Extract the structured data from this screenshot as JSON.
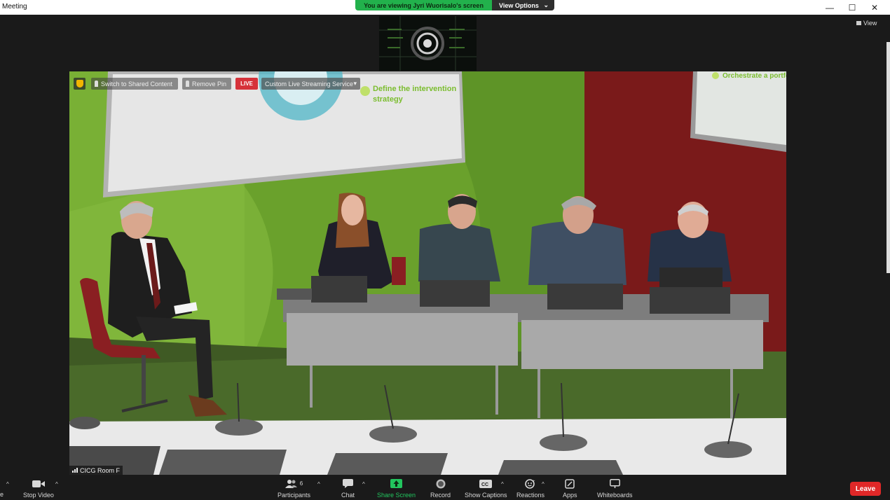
{
  "window": {
    "title": "Meeting"
  },
  "banner": {
    "viewing_text": "You are viewing Jyri Wuorisalo's screen",
    "view_options": "View Options"
  },
  "view_button": {
    "label": "View"
  },
  "video_overlay": {
    "switch_label": "Switch to Shared Content",
    "remove_pin_label": "Remove Pin",
    "live_label": "LIVE",
    "stream_label": "Custom Live Streaming Service"
  },
  "slide_text": {
    "main_slide": "Define the intervention strategy",
    "side_slide": "Orchestrate a portfolio"
  },
  "room": {
    "label": "CICG Room F"
  },
  "toolbar": {
    "stop_video": "Stop Video",
    "participants": "Participants",
    "participants_count": "6",
    "chat": "Chat",
    "share_screen": "Share Screen",
    "record": "Record",
    "show_captions": "Show Captions",
    "reactions": "Reactions",
    "apps": "Apps",
    "whiteboards": "Whiteboards",
    "leave": "Leave"
  },
  "colors": {
    "share_green": "#22c55e",
    "leave_red": "#e02828",
    "banner_green": "#22b14c"
  }
}
